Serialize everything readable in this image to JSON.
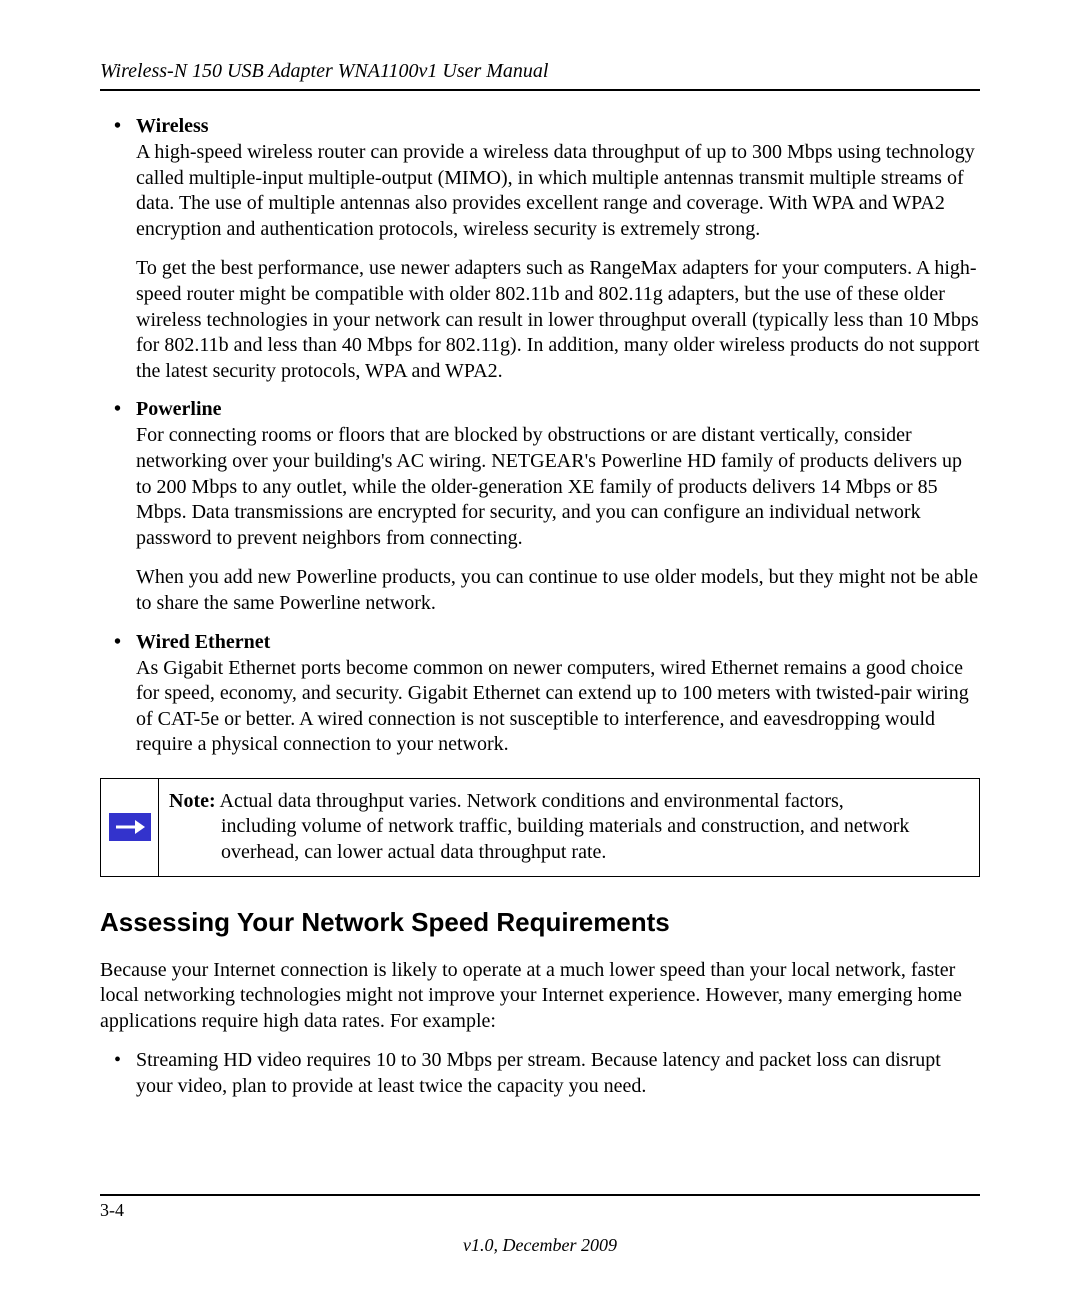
{
  "header": {
    "title": "Wireless-N 150 USB Adapter WNA1100v1 User Manual"
  },
  "bullets": {
    "wireless": {
      "heading": "Wireless",
      "p1": "A high-speed wireless router can provide a wireless data throughput of up to 300 Mbps using technology called multiple-input multiple-output (MIMO), in which multiple antennas transmit multiple streams of data. The use of multiple antennas also provides excellent range and coverage. With WPA and WPA2 encryption and authentication protocols, wireless security is extremely strong.",
      "p2": "To get the best performance, use newer adapters such as RangeMax adapters for your computers. A high-speed router might be compatible with older 802.11b and 802.11g adapters, but the use of these older wireless technologies in your network can result in lower throughput overall (typically less than 10 Mbps for 802.11b and less than 40 Mbps for 802.11g). In addition, many older wireless products do not support the latest security protocols, WPA and WPA2."
    },
    "powerline": {
      "heading": "Powerline",
      "p1": "For connecting rooms or floors that are blocked by obstructions or are distant vertically, consider networking over your building's AC wiring. NETGEAR's Powerline HD family of products delivers up to 200 Mbps to any outlet, while the older-generation XE family of products delivers 14 Mbps or 85 Mbps. Data transmissions are encrypted for security, and you can configure an individual network password to prevent neighbors from connecting.",
      "p2": "When you add new Powerline products, you can continue to use older models, but they might not be able to share the same Powerline network."
    },
    "wired": {
      "heading": "Wired Ethernet",
      "p1": "As Gigabit Ethernet ports become common on newer computers, wired Ethernet remains a good choice for speed, economy, and security. Gigabit Ethernet can extend up to 100 meters with twisted-pair wiring of CAT-5e or better. A wired connection is not susceptible to interference, and eavesdropping would require a physical connection to your network."
    }
  },
  "note": {
    "label": "Note:",
    "line1": " Actual data throughput varies. Network conditions and environmental factors,",
    "line2": "including volume of network traffic, building materials and construction, and network overhead, can lower actual data throughput rate."
  },
  "section": {
    "heading": "Assessing Your Network Speed Requirements",
    "intro": "Because your Internet connection is likely to operate at a much lower speed than your local network, faster local networking technologies might not improve your Internet experience. However, many emerging home applications require high data rates. For example:",
    "bullet1": "Streaming HD video requires 10 to 30 Mbps per stream. Because latency and packet loss can disrupt your video, plan to provide at least twice the capacity you need."
  },
  "footer": {
    "page": "3-4",
    "version": "v1.0, December 2009"
  }
}
